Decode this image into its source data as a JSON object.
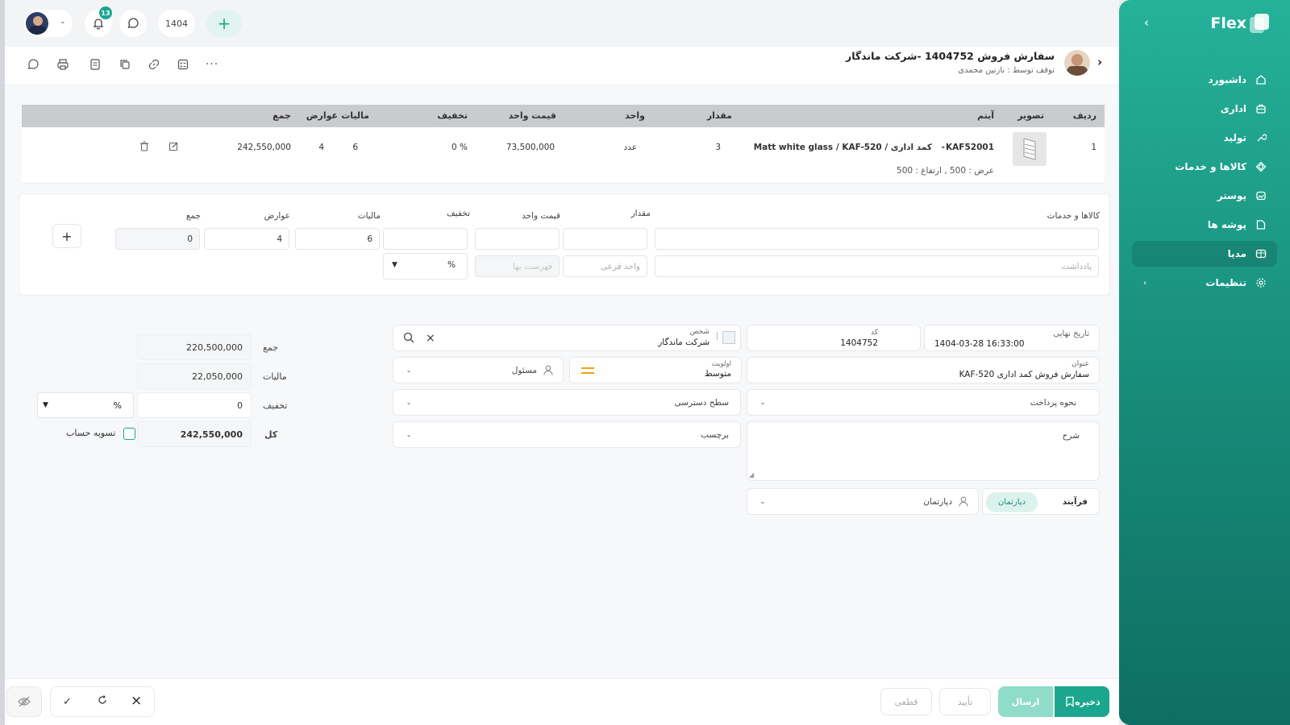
{
  "sidebar": {
    "brand": "Flex",
    "items": [
      {
        "label": "داشبورد",
        "icon": "home-icon"
      },
      {
        "label": "اداری",
        "icon": "briefcase-icon"
      },
      {
        "label": "تولید",
        "icon": "tool-icon"
      },
      {
        "label": "کالاها و خدمات",
        "icon": "products-icon"
      },
      {
        "label": "پوستر",
        "icon": "image-icon"
      },
      {
        "label": "پوشه ها",
        "icon": "folder-icon"
      },
      {
        "label": "مدیا",
        "icon": "media-icon"
      },
      {
        "label": "تنظیمات",
        "icon": "gear-icon"
      }
    ]
  },
  "topbar": {
    "notifications_count": "13",
    "year": "1404"
  },
  "header": {
    "title": "سفارش فروش 1404752 -شرکت ماندگار",
    "subtitle": "توقف توسط : نازنین محمدی"
  },
  "table": {
    "headers": {
      "row": "ردیف",
      "image": "تصویر",
      "item": "آیتم",
      "quantity": "مقدار",
      "unit": "واحد",
      "unit_price": "قیمت واحد",
      "discount": "تخفیف",
      "tax": "مالیات",
      "duties": "عوارض",
      "total": "جمع"
    },
    "rows": [
      {
        "row": "1",
        "item_code": "KAF52001",
        "item_name": "Matt white glass / KAF-520 / کمد اداری",
        "dims": "عرض : 500 ,  ارتفاع : 500",
        "quantity": "3",
        "unit": "عدد",
        "unit_price": "73,500,000",
        "discount": "0 %",
        "tax": "6",
        "duties": "4",
        "total": "242,550,000"
      }
    ]
  },
  "entry": {
    "goods_label": "کالاها و خدمات",
    "quantity_label": "مقدار",
    "unit_price_label": "قیمت واحد",
    "discount_label": "تخفیف",
    "tax_label": "مالیات",
    "duties_label": "عوارض",
    "total_label": "جمع",
    "tax_value": "6",
    "duties_value": "4",
    "total_value": "0",
    "note_placeholder": "یادداشت",
    "subunit_placeholder": "واحد فرعی",
    "pricelist_placeholder": "فهرست بها",
    "discount_type": "%"
  },
  "form": {
    "due_date_label": "تاریخ نهایی",
    "due_date": "1404-03-28 16:33:00",
    "code_label": "کد",
    "code": "1404752",
    "person_label": "شخص",
    "person": "شرکت ماندگار",
    "title_label": "عنوان",
    "title": "سفارش فروش کمد اداری KAF-520",
    "priority_label": "اولویت",
    "priority": "متوسط",
    "responsible": "مسئول",
    "payment_method": "نحوه پرداخت",
    "access_level": "سطح دسترسی",
    "description": "شرح",
    "tag": "برچسب",
    "process_tab": "فرآیند",
    "department_tab": "دپارتمان",
    "department": "دپارتمان"
  },
  "summary": {
    "total_label": "جمع",
    "total": "220,500,000",
    "tax_label": "مالیات",
    "tax": "22,050,000",
    "discount_label": "تخفیف",
    "discount": "0",
    "discount_type": "%",
    "grand_label": "کل",
    "grand": "242,550,000",
    "settle_label": "تسویه حساب"
  },
  "footer": {
    "save": "ذخیره",
    "send": "ارسال",
    "approve": "تأیید",
    "final": "قطعی"
  }
}
